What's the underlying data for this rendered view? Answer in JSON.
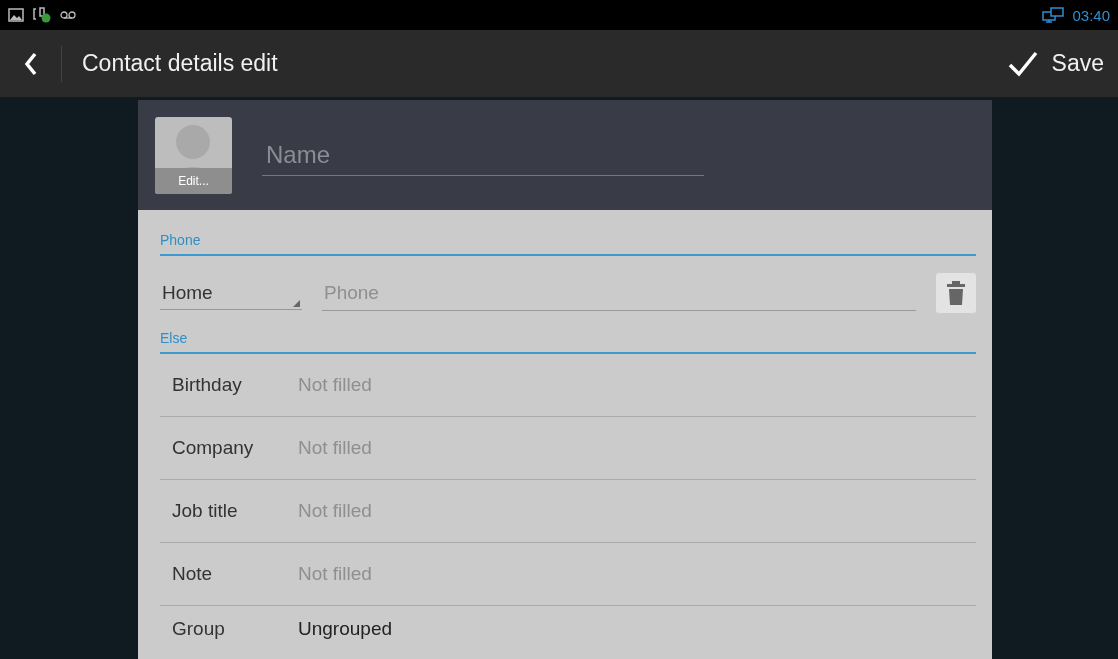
{
  "status_bar": {
    "time": "03:40"
  },
  "action_bar": {
    "title": "Contact details edit",
    "save": "Save"
  },
  "photo": {
    "edit": "Edit..."
  },
  "name_field": {
    "placeholder": "Name"
  },
  "phone_section": {
    "title": "Phone",
    "type": "Home",
    "placeholder": "Phone"
  },
  "else_section": {
    "title": "Else",
    "rows": [
      {
        "label": "Birthday",
        "placeholder": "Not filled"
      },
      {
        "label": "Company",
        "placeholder": "Not filled"
      },
      {
        "label": "Job title",
        "placeholder": "Not filled"
      },
      {
        "label": "Note",
        "placeholder": "Not filled"
      },
      {
        "label": "Group",
        "value": "Ungrouped"
      }
    ]
  }
}
